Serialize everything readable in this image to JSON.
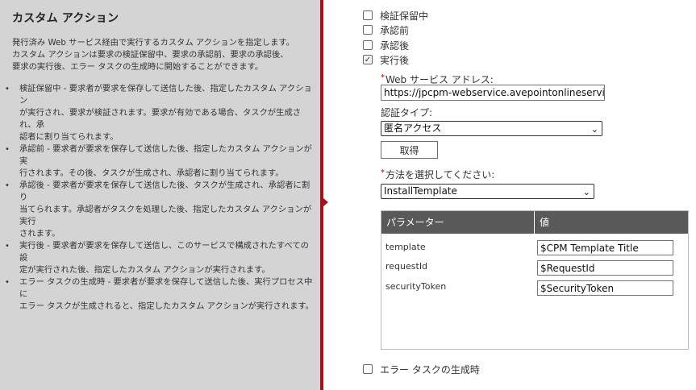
{
  "help": {
    "title": "カスタム アクション",
    "description": [
      "発行済み Web サービス経由で実行するカスタム アクションを指定します。",
      "カスタム アクションは要求の検証保留中、要求の承認前、要求の承認後、",
      "要求の実行後、エラー タスクの生成時に開始することができます。"
    ],
    "bullets": [
      [
        "検証保留中 - 要求者が要求を保存して送信した後、指定したカスタム アクション",
        "が実行され、要求が検証されます。要求が有効である場合、タスクが生成され、承",
        "認者に割り当てられます。"
      ],
      [
        "承認前 - 要求者が要求を保存して送信した後、指定したカスタム アクションが実",
        "行されます。その後、タスクが生成され、承認者に割り当てられます。"
      ],
      [
        "承認後 - 要求者が要求を保存して送信した後、タスクが生成され、承認者に割り",
        "当てられます。承認者がタスクを処理した後、指定したカスタム アクションが実行",
        "されます。"
      ],
      [
        "実行後 - 要求者が要求を保存して送信し、このサービスで構成されたすべての設",
        "定が実行された後、指定したカスタム アクションが実行されます。"
      ],
      [
        "エラー タスクの生成時 - 要求者が要求を保存して送信した後、実行プロセス中に",
        "エラー タスクが生成されると、指定したカスタム アクションが実行されます。"
      ]
    ]
  },
  "triggers": [
    {
      "label": "検証保留中",
      "checked": false
    },
    {
      "label": "承認前",
      "checked": false
    },
    {
      "label": "承認後",
      "checked": false
    },
    {
      "label": "実行後",
      "checked": true
    }
  ],
  "error_trigger": {
    "label": "エラー タスクの生成時",
    "checked": false
  },
  "form": {
    "required_mark": "*",
    "web_service_label": "Web サービス アドレス:",
    "web_service_value": "https://jpcpm-webservice.avepointonlineservices",
    "auth_type_label": "認証タイプ:",
    "auth_type_value": "匿名アクセス",
    "get_button": "取得",
    "method_label": "方法を選択してください:",
    "method_value": "InstallTemplate"
  },
  "parameters": {
    "headers": [
      "パラメーター",
      "値"
    ],
    "rows": [
      {
        "name": "template",
        "value": "$CPM Template Title"
      },
      {
        "name": "requestId",
        "value": "$RequestId"
      },
      {
        "name": "securityToken",
        "value": "$SecurityToken"
      }
    ]
  },
  "icons": {
    "checkmark": "✓",
    "chevron": "⌄",
    "bullet": "•"
  },
  "colors": {
    "divider": "#a8101c",
    "panel": "#d4d4d4",
    "table_header": "#595959"
  }
}
